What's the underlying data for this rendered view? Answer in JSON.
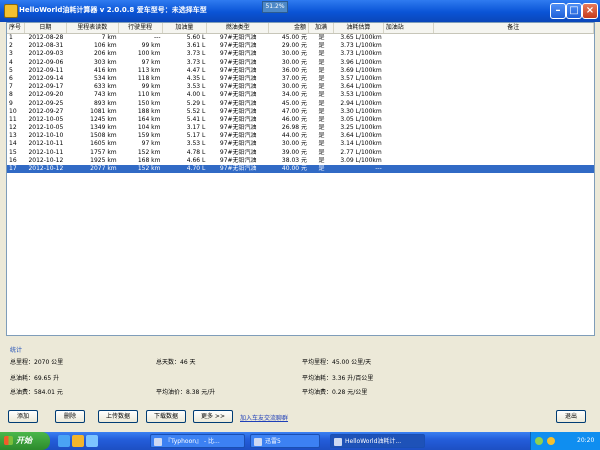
{
  "window": {
    "title": "HelloWorld油耗计算器 v 2.0.0.8  爱车型号：未选择车型",
    "badge": "51.2%"
  },
  "columns": [
    "序号",
    "日期",
    "里程表读数",
    "行驶里程",
    "加油量",
    "燃油类型",
    "金额",
    "加满",
    "油耗估算",
    "加油站",
    "备注"
  ],
  "rows": [
    [
      "1",
      "2012-08-28",
      "7 km",
      "---",
      "5.60 L",
      "97#无铅汽油",
      "45.00 元",
      "是",
      "3.65 L/100km",
      "",
      ""
    ],
    [
      "2",
      "2012-08-31",
      "106 km",
      "99 km",
      "3.61 L",
      "97#无铅汽油",
      "29.00 元",
      "是",
      "3.73 L/100km",
      "",
      ""
    ],
    [
      "3",
      "2012-09-03",
      "206 km",
      "100 km",
      "3.73 L",
      "97#无铅汽油",
      "30.00 元",
      "是",
      "3.73 L/100km",
      "",
      ""
    ],
    [
      "4",
      "2012-09-06",
      "303 km",
      "97 km",
      "3.73 L",
      "97#无铅汽油",
      "30.00 元",
      "是",
      "3.96 L/100km",
      "",
      ""
    ],
    [
      "5",
      "2012-09-11",
      "416 km",
      "113 km",
      "4.47 L",
      "97#无铅汽油",
      "36.00 元",
      "是",
      "3.69 L/100km",
      "",
      ""
    ],
    [
      "6",
      "2012-09-14",
      "534 km",
      "118 km",
      "4.35 L",
      "97#无铅汽油",
      "37.00 元",
      "是",
      "3.57 L/100km",
      "",
      ""
    ],
    [
      "7",
      "2012-09-17",
      "633 km",
      "99 km",
      "3.53 L",
      "97#无铅汽油",
      "30.00 元",
      "是",
      "3.64 L/100km",
      "",
      ""
    ],
    [
      "8",
      "2012-09-20",
      "743 km",
      "110 km",
      "4.00 L",
      "97#无铅汽油",
      "34.00 元",
      "是",
      "3.53 L/100km",
      "",
      ""
    ],
    [
      "9",
      "2012-09-25",
      "893 km",
      "150 km",
      "5.29 L",
      "97#无铅汽油",
      "45.00 元",
      "是",
      "2.94 L/100km",
      "",
      ""
    ],
    [
      "10",
      "2012-09-27",
      "1081 km",
      "188 km",
      "5.52 L",
      "97#无铅汽油",
      "47.00 元",
      "是",
      "3.30 L/100km",
      "",
      ""
    ],
    [
      "11",
      "2012-10-05",
      "1245 km",
      "164 km",
      "5.41 L",
      "97#无铅汽油",
      "46.00 元",
      "是",
      "3.05 L/100km",
      "",
      ""
    ],
    [
      "12",
      "2012-10-05",
      "1349 km",
      "104 km",
      "3.17 L",
      "97#无铅汽油",
      "26.98 元",
      "是",
      "3.25 L/100km",
      "",
      ""
    ],
    [
      "13",
      "2012-10-10",
      "1508 km",
      "159 km",
      "5.17 L",
      "97#无铅汽油",
      "44.00 元",
      "是",
      "3.64 L/100km",
      "",
      ""
    ],
    [
      "14",
      "2012-10-11",
      "1605 km",
      "97 km",
      "3.53 L",
      "97#无铅汽油",
      "30.00 元",
      "是",
      "3.14 L/100km",
      "",
      ""
    ],
    [
      "15",
      "2012-10-11",
      "1757 km",
      "152 km",
      "4.78 L",
      "97#无铅汽油",
      "39.00 元",
      "是",
      "2.77 L/100km",
      "",
      ""
    ],
    [
      "16",
      "2012-10-12",
      "1925 km",
      "168 km",
      "4.66 L",
      "97#无铅汽油",
      "38.03 元",
      "是",
      "3.09 L/100km",
      "",
      ""
    ],
    [
      "17",
      "2012-10-12",
      "2077 km",
      "152 km",
      "4.70 L",
      "97#无铅汽油",
      "40.00 元",
      "是",
      "---",
      "",
      ""
    ]
  ],
  "stats": {
    "label": "统计",
    "total_mileage": "总里程：2070 公里",
    "total_days": "总天数：46 天",
    "avg_mileage": "平均里程：45.00 公里/天",
    "total_fuel": "总油耗：69.65 升",
    "avg_fuel": "平均油耗：3.36 升/百公里",
    "total_cost": "总油费：584.01 元",
    "avg_price": "平均油价：8.38 元/升",
    "avg_cost": "平均油费：0.28 元/公里"
  },
  "buttons": {
    "add": "添加",
    "delete": "删除",
    "upload": "上传数据",
    "download": "下载数据",
    "more": "更多 >>",
    "join_link": "加入车友交流聊群",
    "exit": "退出"
  },
  "taskbar": {
    "start": "开始",
    "tasks": [
      "『Typhoon』 - 比...",
      "迅雷5",
      "HelloWorld油耗计..."
    ],
    "clock": "20:20"
  }
}
